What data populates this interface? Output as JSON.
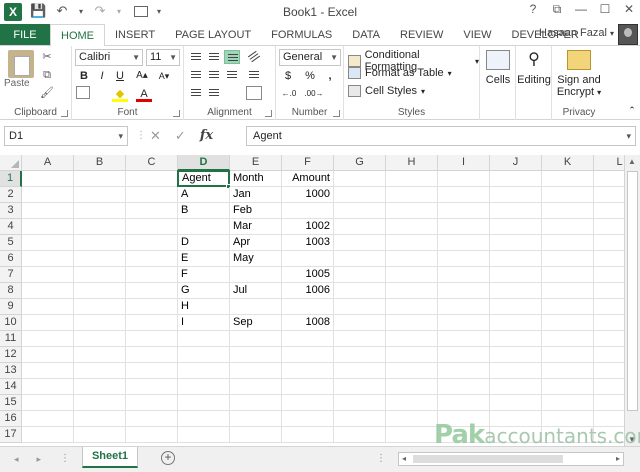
{
  "window": {
    "title": "Book1 - Excel",
    "help": "?",
    "restore": "⧉",
    "minimize": "—",
    "maximize": "☐",
    "close": "✕"
  },
  "qat": {
    "save": "💾",
    "undo": "↶",
    "undo_arrow": "▾",
    "redo": "↷",
    "redo_arrow": "▾",
    "customize": "▾"
  },
  "tabs": [
    {
      "label": "FILE"
    },
    {
      "label": "HOME"
    },
    {
      "label": "INSERT"
    },
    {
      "label": "PAGE LAYOUT"
    },
    {
      "label": "FORMULAS"
    },
    {
      "label": "DATA"
    },
    {
      "label": "REVIEW"
    },
    {
      "label": "VIEW"
    },
    {
      "label": "DEVELOPER"
    }
  ],
  "user": {
    "name": "Hasaan Fazal",
    "arrow": "▾"
  },
  "ribbon": {
    "clipboard": {
      "label": "Clipboard",
      "paste": "Paste"
    },
    "font": {
      "label": "Font",
      "name": "Calibri",
      "size": "11",
      "bold": "B",
      "italic": "I",
      "underline": "U",
      "grow": "A▴",
      "shrink": "A▾",
      "fill": "◆",
      "color": "A"
    },
    "alignment": {
      "label": "Alignment"
    },
    "number": {
      "label": "Number",
      "format": "General",
      "currency": "$",
      "percent": "%",
      "comma": ",",
      "inc_decimal": "←.0",
      "dec_decimal": ".00→"
    },
    "styles": {
      "label": "Styles",
      "conditional": "Conditional Formatting",
      "format_table": "Format as Table",
      "cell_styles": "Cell Styles"
    },
    "cells": {
      "label": "Cells"
    },
    "editing": {
      "label": "Editing"
    },
    "privacy": {
      "label": "Privacy",
      "sign": "Sign and",
      "encrypt": "Encrypt"
    }
  },
  "formula_bar": {
    "name_box": "D1",
    "content": "Agent",
    "cancel": "✕",
    "enter": "✓",
    "fx": "fx",
    "arrow": "▾"
  },
  "columns": [
    "A",
    "B",
    "C",
    "D",
    "E",
    "F",
    "G",
    "H",
    "I",
    "J",
    "K",
    "L"
  ],
  "rows": [
    "1",
    "2",
    "3",
    "4",
    "5",
    "6",
    "7",
    "8",
    "9",
    "10",
    "11",
    "12",
    "13",
    "14",
    "15",
    "16",
    "17"
  ],
  "cells": {
    "D1": "Agent",
    "E1": "Month",
    "F1": "Amount",
    "D2": "A",
    "E2": "Jan",
    "F2": "1000",
    "D3": "B",
    "E3": "Feb",
    "E4": "Mar",
    "F4": "1002",
    "D5": "D",
    "E5": "Apr",
    "F5": "1003",
    "D6": "E",
    "E6": "May",
    "D7": "F",
    "F7": "1005",
    "D8": "G",
    "E8": "Jul",
    "F8": "1006",
    "D9": "H",
    "D10": "I",
    "E10": "Sep",
    "F10": "1008"
  },
  "sheet": {
    "tab": "Sheet1",
    "add": "+",
    "ellipsis": "⋮",
    "prev": "◂",
    "next": "▸"
  },
  "scroll": {
    "up": "▲",
    "down": "▼",
    "left": "◂",
    "right": "▸"
  },
  "watermark": {
    "main": "Pak",
    "sub": "accountants.com"
  }
}
